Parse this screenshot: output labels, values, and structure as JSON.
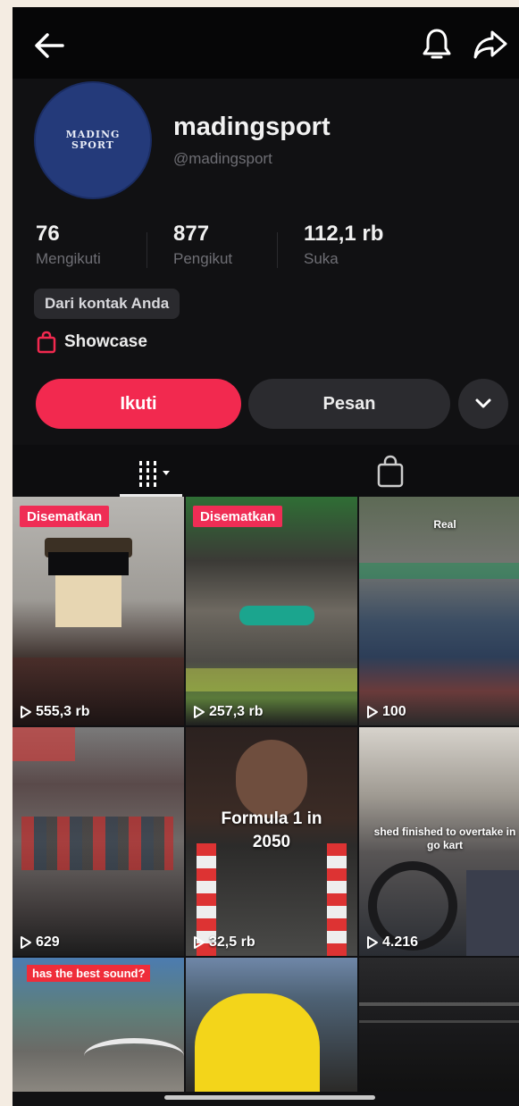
{
  "profile": {
    "display_name": "madingsport",
    "handle": "@madingsport",
    "avatar_logo_lines": [
      "MADING",
      "SPORT"
    ]
  },
  "stats": [
    {
      "value": "76",
      "label": "Mengikuti"
    },
    {
      "value": "877",
      "label": "Pengikut"
    },
    {
      "value": "112,1 rb",
      "label": "Suka"
    }
  ],
  "contact_chip": "Dari kontak Anda",
  "showcase_label": "Showcase",
  "actions": {
    "follow_label": "Ikuti",
    "message_label": "Pesan"
  },
  "colors": {
    "accent": "#f2294f",
    "pinned_badge": "#ef2d55",
    "background": "#111113",
    "avatar": "#243a7a"
  },
  "icons": {
    "back": "arrow-left-icon",
    "bell": "bell-icon",
    "share": "share-arrow-icon",
    "more": "chevron-down-icon",
    "grid_tab": "grid-sort-icon",
    "shop_tab": "shopping-bag-icon"
  },
  "videos": [
    {
      "views": "555,3 rb",
      "pinned": "Disematkan",
      "overlay": ""
    },
    {
      "views": "257,3 rb",
      "pinned": "Disematkan",
      "overlay": ""
    },
    {
      "views": "100",
      "pinned": "",
      "overlay": "Real"
    },
    {
      "views": "629",
      "pinned": "",
      "overlay": ""
    },
    {
      "views": "32,5 rb",
      "pinned": "",
      "overlay": "Formula 1 in 2050"
    },
    {
      "views": "4.216",
      "pinned": "",
      "overlay": "shed finished to overtake in go kart"
    },
    {
      "views": "",
      "pinned": "",
      "overlay": "has the best sound?"
    },
    {
      "views": "",
      "pinned": "",
      "overlay": ""
    },
    {
      "views": "",
      "pinned": "",
      "overlay": ""
    }
  ]
}
